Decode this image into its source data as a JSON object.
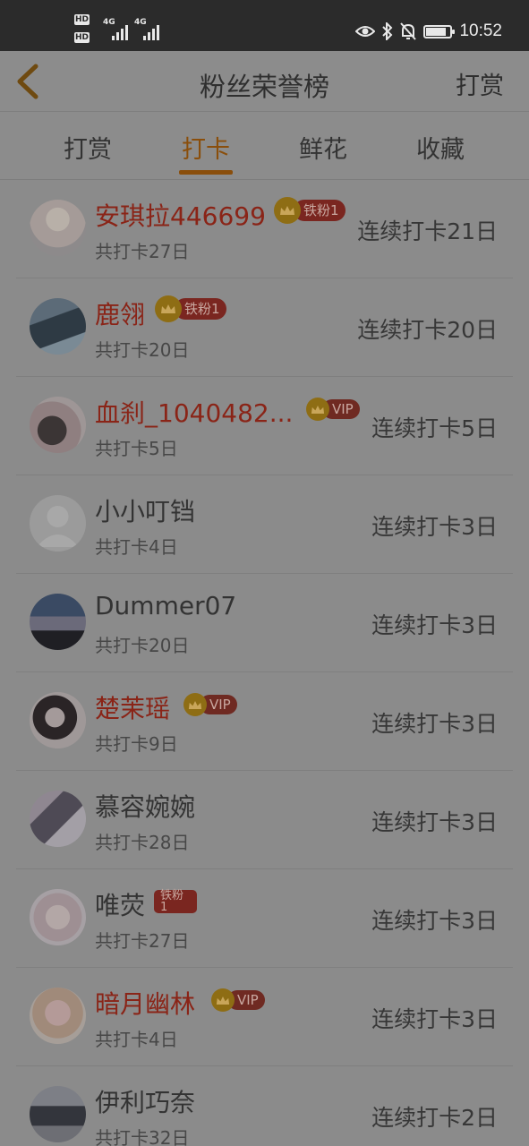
{
  "status_bar": {
    "time": "10:52",
    "network_1": "4G",
    "network_2": "4G",
    "hd_1": "HD",
    "hd_2": "HD"
  },
  "header": {
    "title": "粉丝荣誉榜",
    "right_action": "打赏"
  },
  "tabs": [
    {
      "label": "打赏",
      "active": false
    },
    {
      "label": "打卡",
      "active": true
    },
    {
      "label": "鲜花",
      "active": false
    },
    {
      "label": "收藏",
      "active": false
    }
  ],
  "fans": [
    {
      "name": "安琪拉446699",
      "badge": "铁粉1",
      "total": "共打卡27日",
      "streak": "连续打卡21日",
      "vip_color": true
    },
    {
      "name": "鹿翎",
      "badge": "铁粉1",
      "total": "共打卡20日",
      "streak": "连续打卡20日",
      "vip_color": true
    },
    {
      "name": "血刹_1040482...",
      "badge": "VIP",
      "total": "共打卡5日",
      "streak": "连续打卡5日",
      "vip_color": true
    },
    {
      "name": "小小叮铛",
      "badge": "",
      "total": "共打卡4日",
      "streak": "连续打卡3日",
      "vip_color": false
    },
    {
      "name": "Dummer07",
      "badge": "",
      "total": "共打卡20日",
      "streak": "连续打卡3日",
      "vip_color": false
    },
    {
      "name": "楚茉瑶",
      "badge": "VIP",
      "total": "共打卡9日",
      "streak": "连续打卡3日",
      "vip_color": true
    },
    {
      "name": "慕容婉婉",
      "badge": "",
      "total": "共打卡28日",
      "streak": "连续打卡3日",
      "vip_color": false
    },
    {
      "name": "唯荧",
      "badge": "铁粉1",
      "total": "共打卡27日",
      "streak": "连续打卡3日",
      "vip_color": false
    },
    {
      "name": "暗月幽林",
      "badge": "VIP",
      "total": "共打卡4日",
      "streak": "连续打卡3日",
      "vip_color": true
    },
    {
      "name": "伊利巧奈",
      "badge": "",
      "total": "共打卡32日",
      "streak": "连续打卡2日",
      "vip_color": false
    }
  ],
  "colors": {
    "accent": "#8a4e0b",
    "vip_name": "#8a2417",
    "badge_red": "#7a2620",
    "crown_gold": "#8e6d14"
  }
}
